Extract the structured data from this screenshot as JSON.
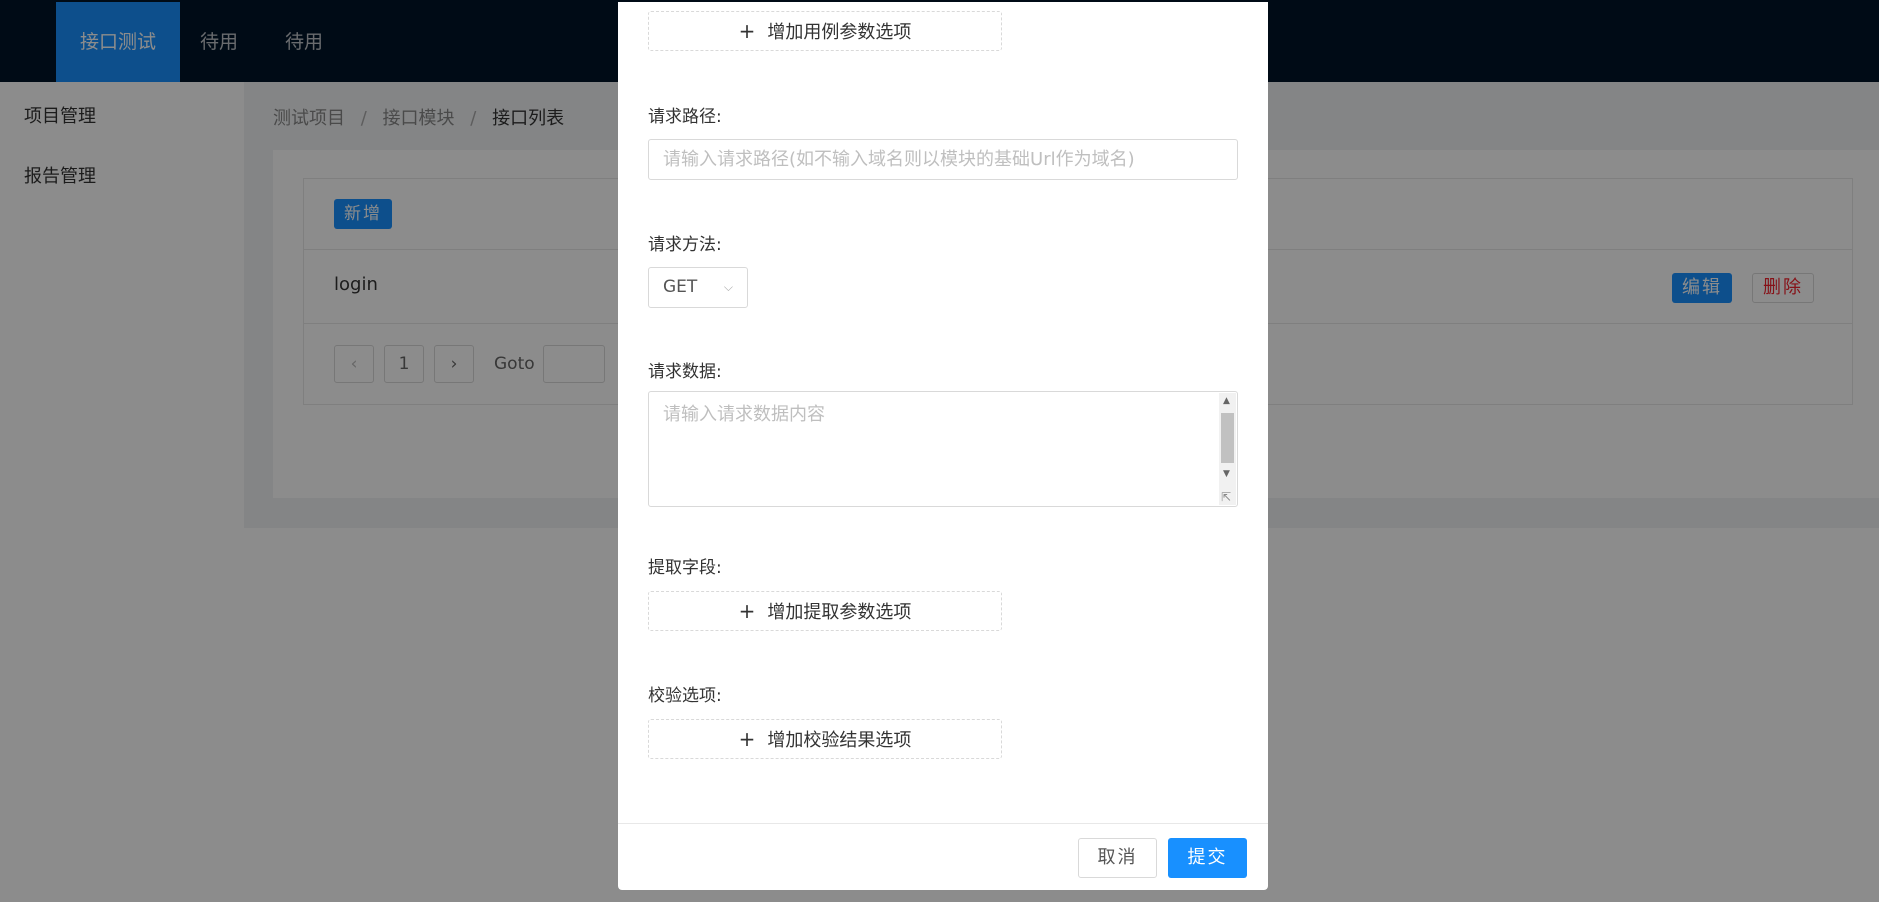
{
  "topnav": {
    "items": [
      {
        "label": "接口测试",
        "active": true
      },
      {
        "label": "待用",
        "active": false
      },
      {
        "label": "待用",
        "active": false
      }
    ]
  },
  "sidebar": {
    "items": [
      {
        "label": "项目管理"
      },
      {
        "label": "报告管理"
      }
    ]
  },
  "breadcrumb": [
    "测试项目",
    "接口模块",
    "接口列表"
  ],
  "breadcrumb_separator": "/",
  "list": {
    "add_label": "新增",
    "rows": [
      {
        "name": "login",
        "edit_label": "编辑",
        "delete_label": "删除"
      }
    ],
    "pagination": {
      "prev_icon": "‹",
      "page": "1",
      "next_icon": "›",
      "goto_label": "Goto"
    }
  },
  "modal": {
    "add_case_param": "增加用例参数选项",
    "path_label": "请求路径:",
    "path_placeholder": "请输入请求路径(如不输入域名则以模块的基础Url作为域名)",
    "method_label": "请求方法:",
    "method_value": "GET",
    "data_label": "请求数据:",
    "data_placeholder": "请输入请求数据内容",
    "extract_label": "提取字段:",
    "add_extract_param": "增加提取参数选项",
    "verify_label": "校验选项:",
    "add_verify_option": "增加校验结果选项",
    "cancel_label": "取消",
    "submit_label": "提交"
  },
  "colors": {
    "primary": "#1890ff",
    "nav_bg": "#001529",
    "danger": "#f5222d"
  }
}
